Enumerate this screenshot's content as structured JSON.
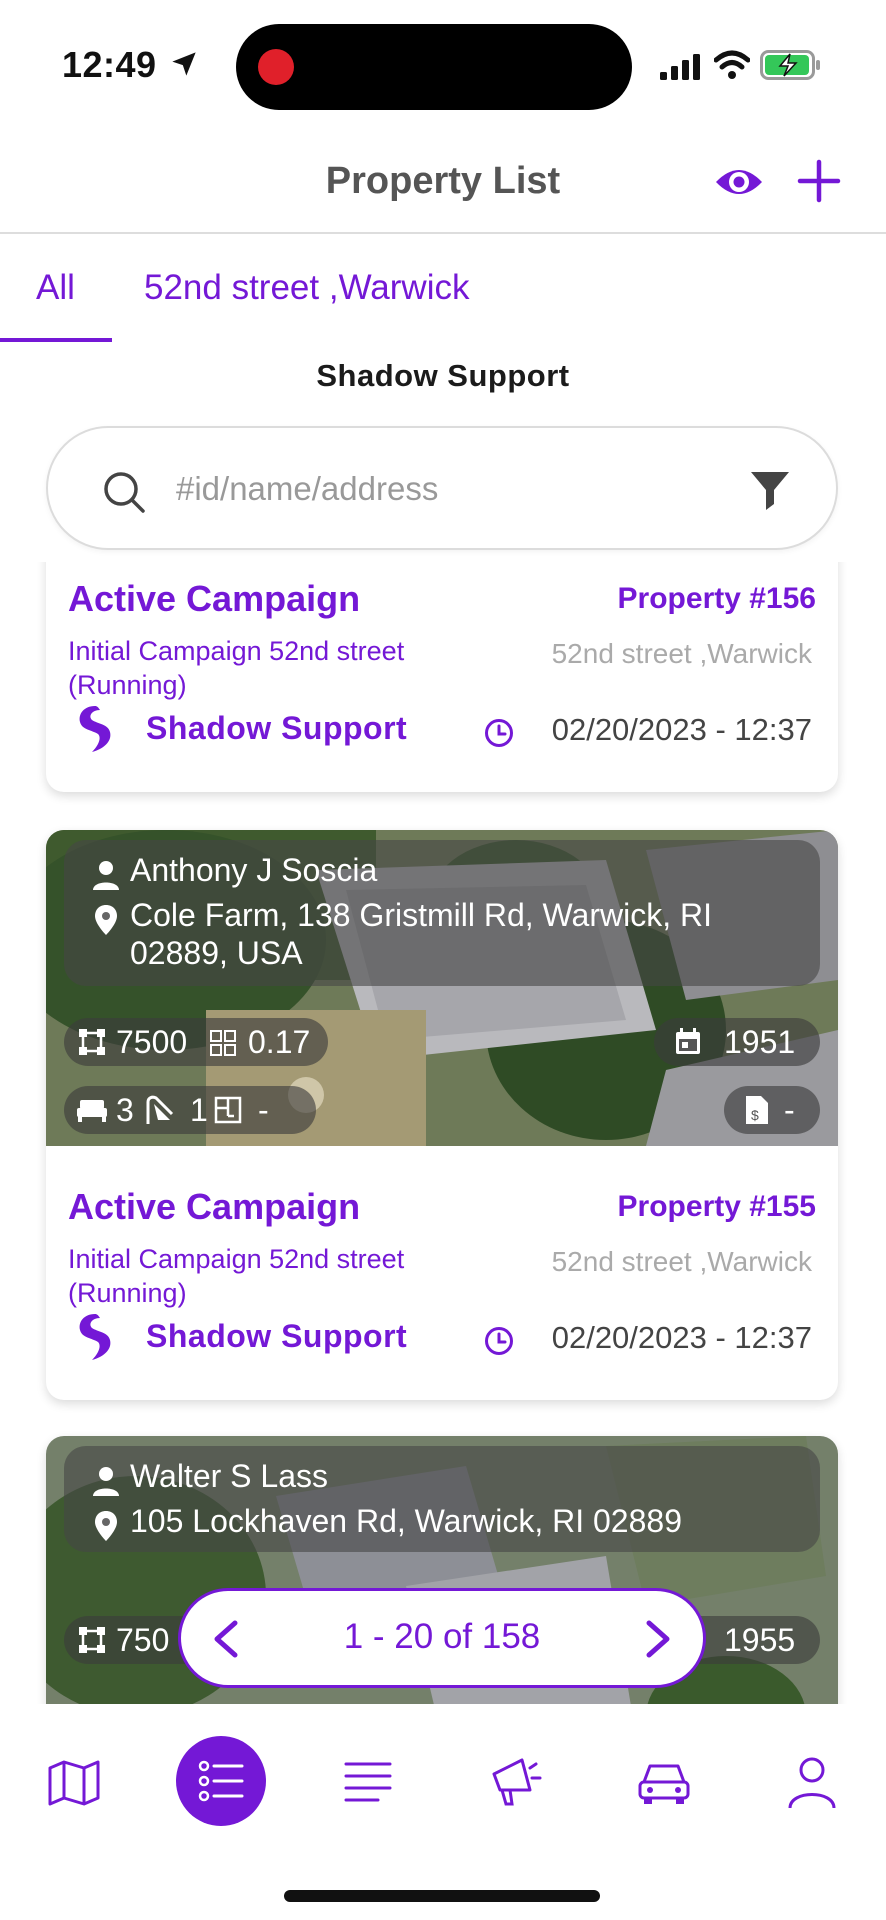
{
  "status_bar": {
    "time": "12:49"
  },
  "header": {
    "title": "Property List"
  },
  "tabs": [
    {
      "label": "All",
      "active": true
    },
    {
      "label": "52nd street ,Warwick",
      "active": false
    }
  ],
  "team_name": "Shadow  Support",
  "search": {
    "placeholder": "#id/name/address",
    "value": ""
  },
  "properties": [
    {
      "status": "Active Campaign",
      "id": "Property #156",
      "campaign": "Initial Campaign 52nd street (Running)",
      "location": "52nd street ,Warwick",
      "team": "Shadow  Support",
      "datetime": "02/20/2023 - 12:37"
    },
    {
      "owner": "Anthony J Soscia",
      "address": "Cole Farm, 138 Gristmill Rd, Warwick, RI 02889, USA",
      "sqft": "7500",
      "acres": "0.17",
      "year": "1951",
      "beds": "3",
      "baths": "1",
      "floor_plan": "-",
      "price": "-",
      "status": "Active Campaign",
      "id": "Property #155",
      "campaign": "Initial Campaign 52nd street (Running)",
      "location": "52nd street ,Warwick",
      "team": "Shadow  Support",
      "datetime": "02/20/2023 - 12:37"
    },
    {
      "owner": "Walter S Lass",
      "address": "105 Lockhaven Rd, Warwick, RI 02889",
      "sqft": "750",
      "year": "1955"
    }
  ],
  "pagination": {
    "label": "1 - 20 of 158"
  },
  "bottom_nav": [
    {
      "name": "map",
      "active": false
    },
    {
      "name": "property-list",
      "active": true
    },
    {
      "name": "lists",
      "active": false
    },
    {
      "name": "campaigns",
      "active": false
    },
    {
      "name": "driving",
      "active": false
    },
    {
      "name": "profile",
      "active": false
    }
  ],
  "colors": {
    "accent": "#7418d6",
    "muted": "#aaaaaa"
  }
}
